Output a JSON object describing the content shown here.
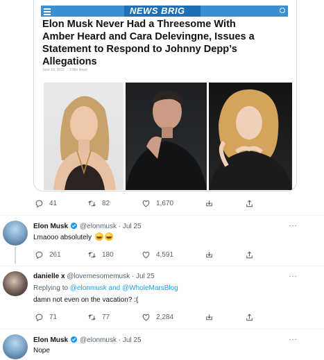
{
  "article": {
    "site_name": "NEWS BRIG",
    "headline": "Elon Musk Never Had a Threesome With Amber Heard and Cara Delevingne, Issues a Statement to Respond to Johnny Depp’s Allegations",
    "date": "June 19, 2022",
    "read_time": "3 Min Read"
  },
  "tweets": [
    {
      "stats": {
        "replies": "41",
        "retweets": "82",
        "likes": "1,670"
      }
    },
    {
      "name": "Elon Musk",
      "handle": "@elonmusk",
      "date": "· Jul 25",
      "text": "Lmaooo absolutely",
      "stats": {
        "replies": "261",
        "retweets": "180",
        "likes": "4,591"
      }
    },
    {
      "name": "danielle x",
      "handle": "@lovemesomemusk",
      "date": "· Jul 25",
      "reply_prefix": "Replying to",
      "reply_to_1": "@elonmusk",
      "reply_and": "and",
      "reply_to_2": "@WholeMarsBlog",
      "text": "damn not even on the vacation? :(",
      "stats": {
        "replies": "71",
        "retweets": "77",
        "likes": "2,284"
      }
    },
    {
      "name": "Elon Musk",
      "handle": "@elonmusk",
      "date": "· Jul 25",
      "text": "Nope"
    }
  ],
  "more_label": "···",
  "icons": {
    "reply": "reply-icon",
    "retweet": "retweet-icon",
    "like": "heart-icon",
    "share_tray": "share-tray-icon",
    "upload": "upload-icon",
    "verified": "verified-badge-icon",
    "menu": "hamburger-icon",
    "search": "search-icon"
  },
  "colors": {
    "twitter_blue": "#1d9bf0",
    "text_secondary": "#536471",
    "news_bar": "#3a8fd3"
  }
}
